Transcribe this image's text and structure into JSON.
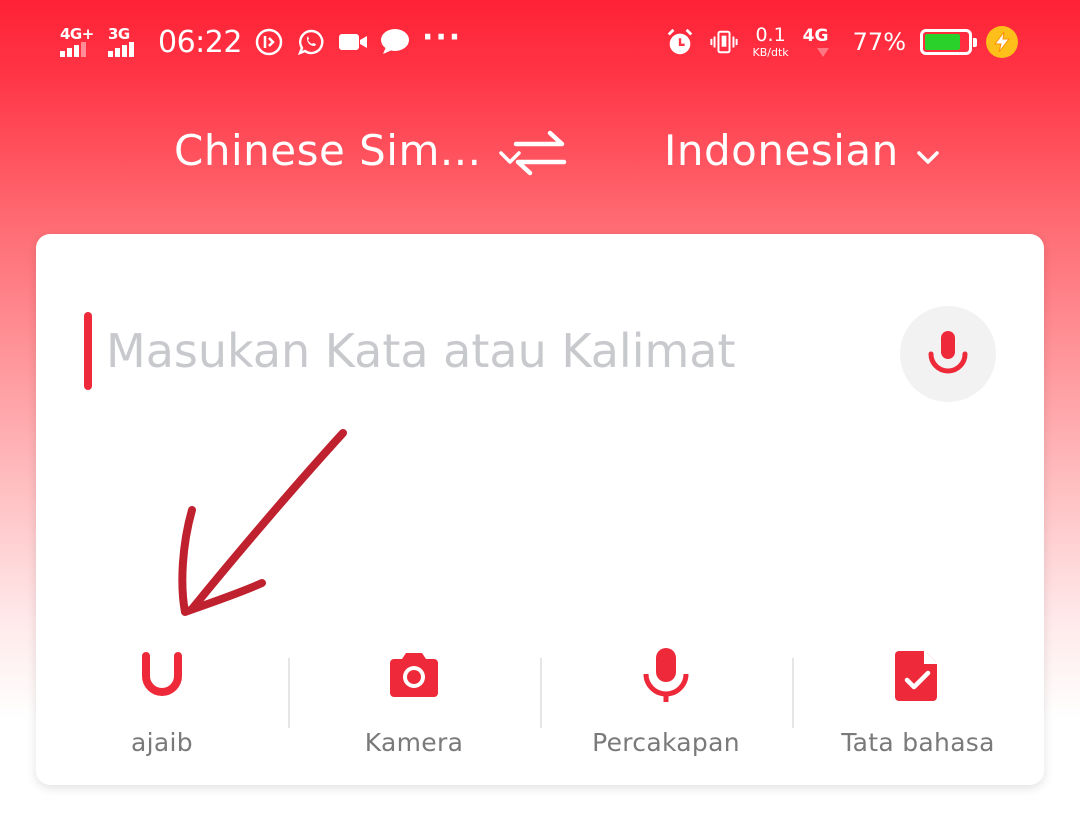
{
  "status_bar": {
    "sim1": "4G+",
    "sim2": "3G",
    "time": "06:22",
    "speed_value": "0.1",
    "speed_unit": "KB/dtk",
    "network": "4G",
    "battery_percent": "77%",
    "battery_level": 0.77,
    "icons": [
      "notification-icon",
      "whatsapp-icon",
      "video-call-icon",
      "message-icon",
      "more-dots-icon",
      "alarm-icon",
      "vibrate-icon",
      "battery-icon",
      "charging-icon"
    ]
  },
  "lang_bar": {
    "source": "Chinese Sim...",
    "target": "Indonesian"
  },
  "input": {
    "placeholder": "Masukan Kata atau Kalimat",
    "value": ""
  },
  "tools": [
    {
      "label": "ajaib",
      "icon": "magic-u-icon"
    },
    {
      "label": "Kamera",
      "icon": "camera-icon"
    },
    {
      "label": "Percakapan",
      "icon": "microphone-icon"
    },
    {
      "label": "Tata bahasa",
      "icon": "grammar-document-icon"
    }
  ],
  "colors": {
    "accent": "#ee2a3a",
    "header_top": "#ff2236",
    "annotation": "#c0212e",
    "battery_fill": "#2bd12b"
  }
}
